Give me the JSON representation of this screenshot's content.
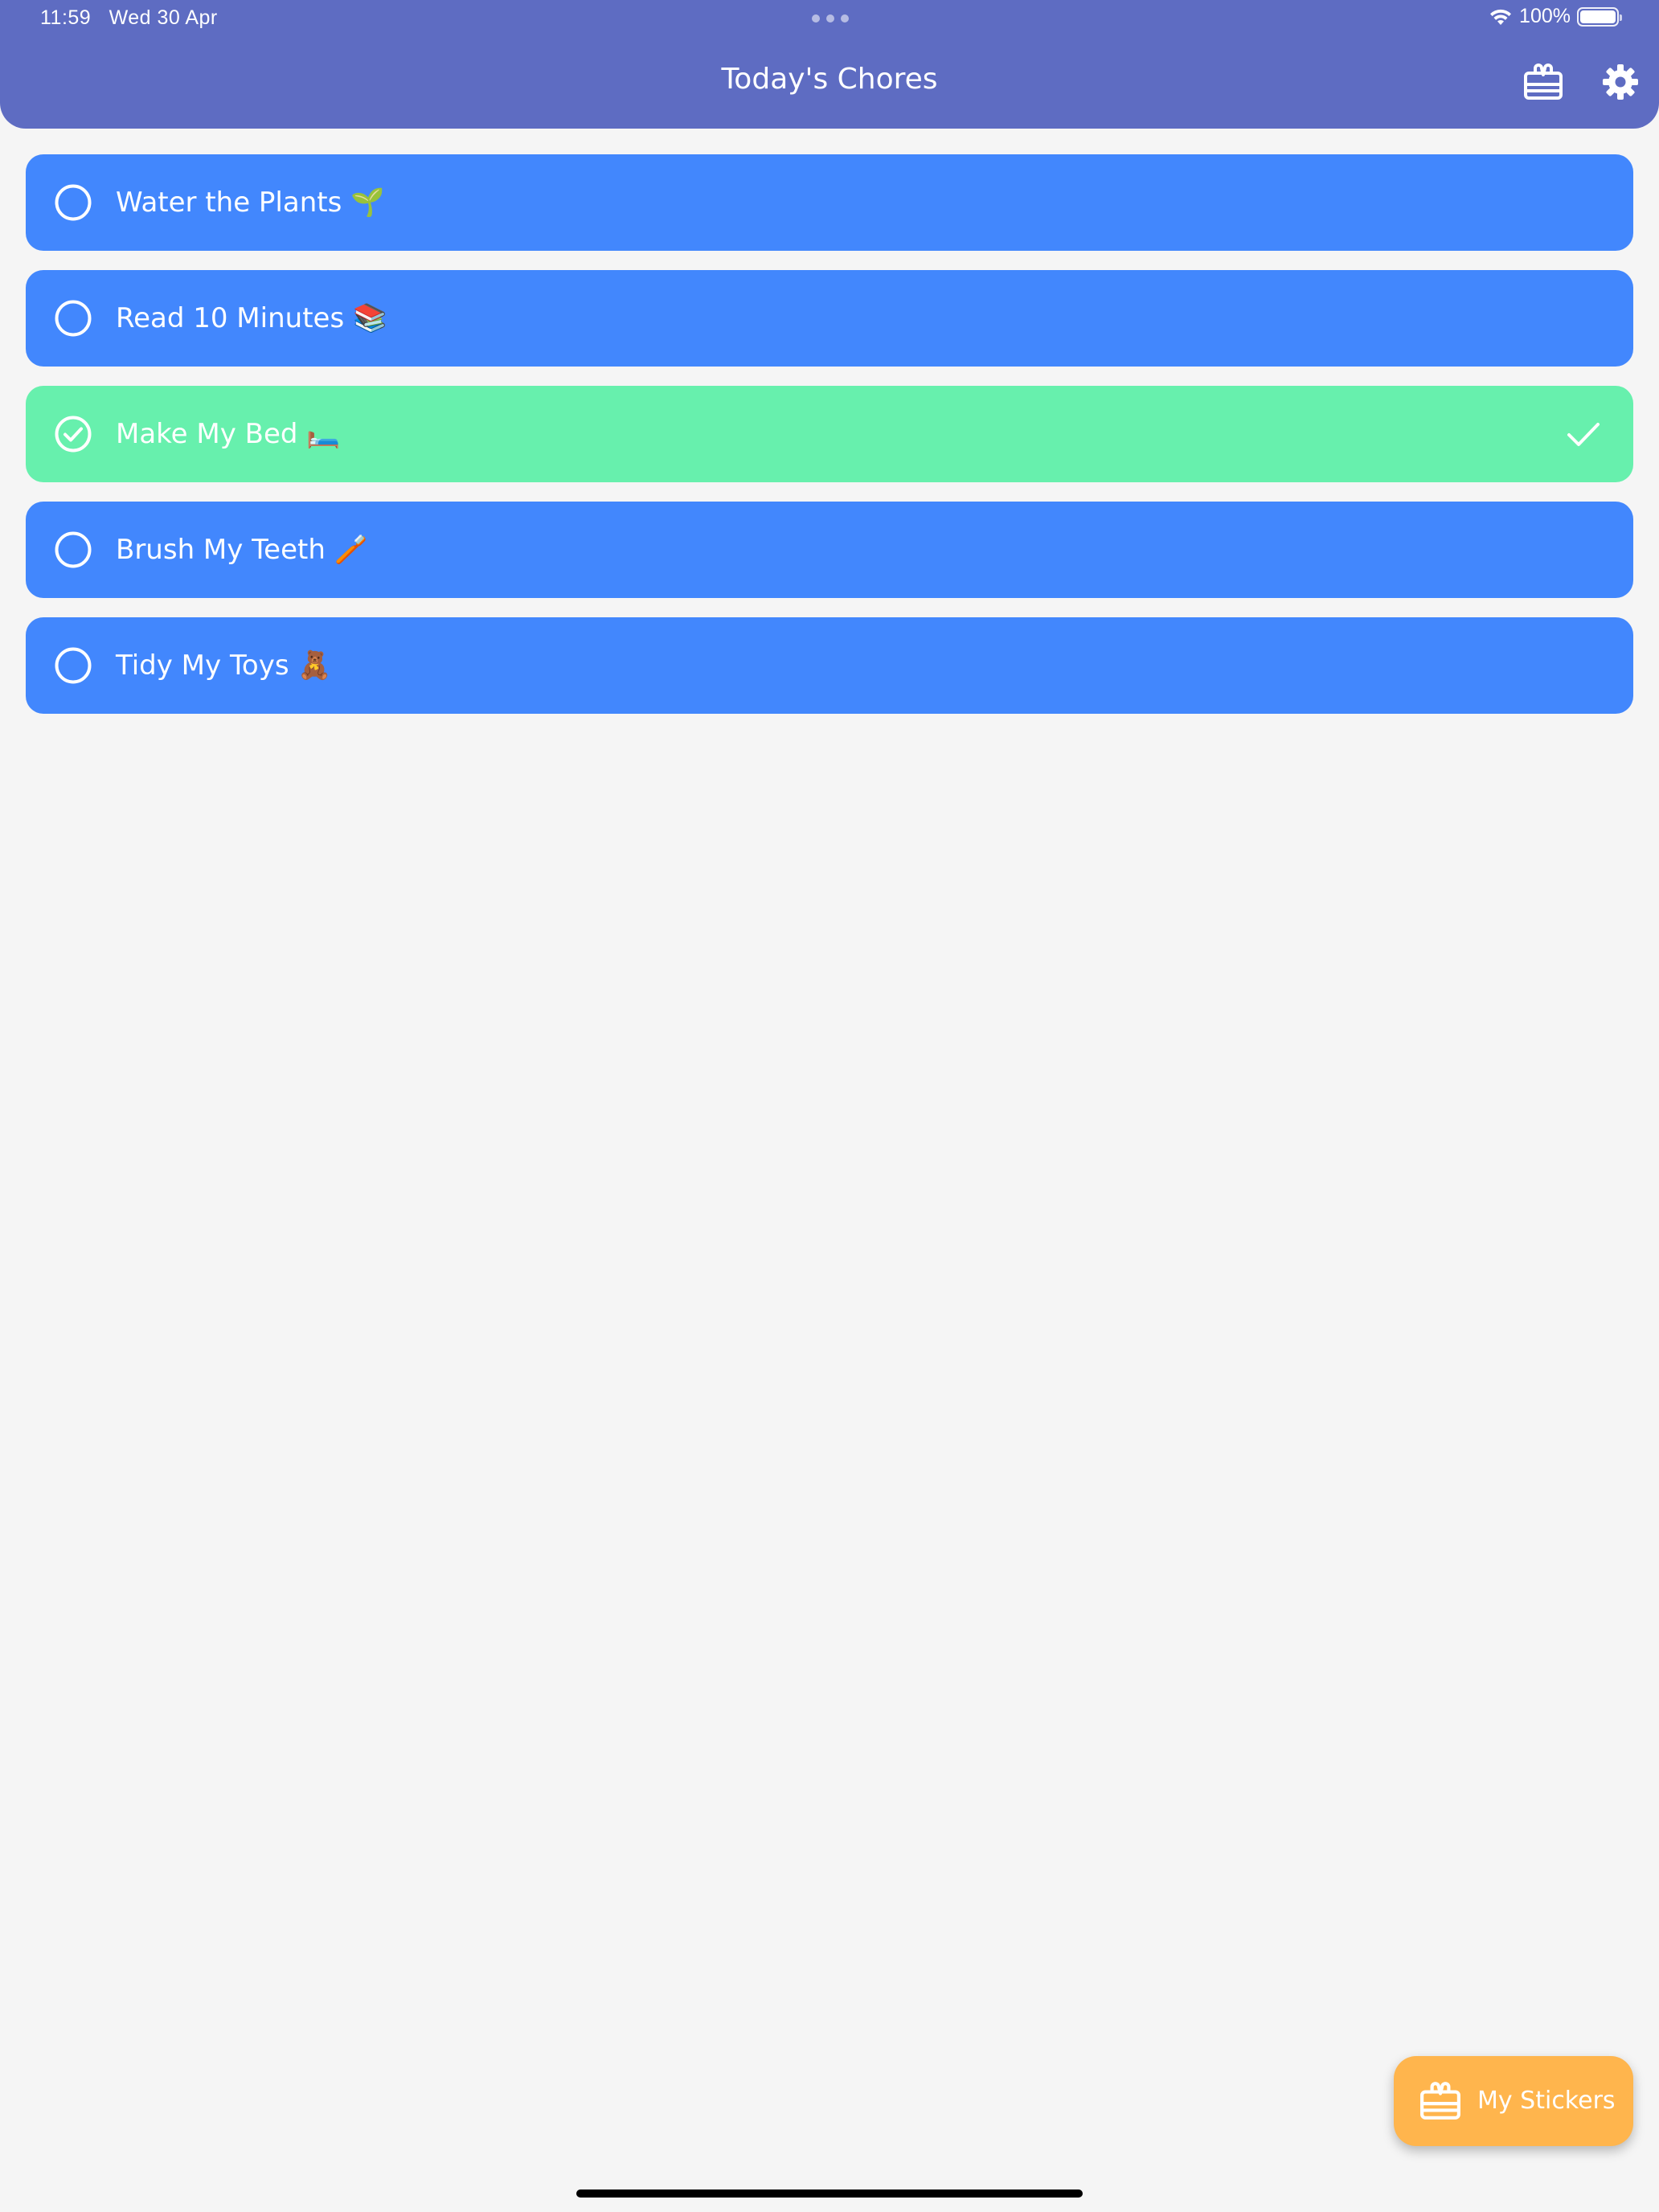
{
  "status_bar": {
    "time": "11:59",
    "date": "Wed 30 Apr",
    "battery": "100%"
  },
  "header": {
    "title": "Today's Chores",
    "stickers_icon": "gift-icon",
    "settings_icon": "gear-icon"
  },
  "chores": [
    {
      "label": "Water the Plants 🌱",
      "done": false
    },
    {
      "label": "Read 10 Minutes 📚",
      "done": false
    },
    {
      "label": "Make My Bed 🛏️",
      "done": true
    },
    {
      "label": "Brush My Teeth 🪥",
      "done": false
    },
    {
      "label": "Tidy My Toys 🧸",
      "done": false
    }
  ],
  "fab": {
    "label": "My Stickers",
    "icon": "gift-icon"
  },
  "colors": {
    "header": "#5e6cc2",
    "chore_pending": "#4287fd",
    "chore_done": "#67f0ad",
    "fab": "#ffb54d",
    "background": "#f5f5f5"
  }
}
